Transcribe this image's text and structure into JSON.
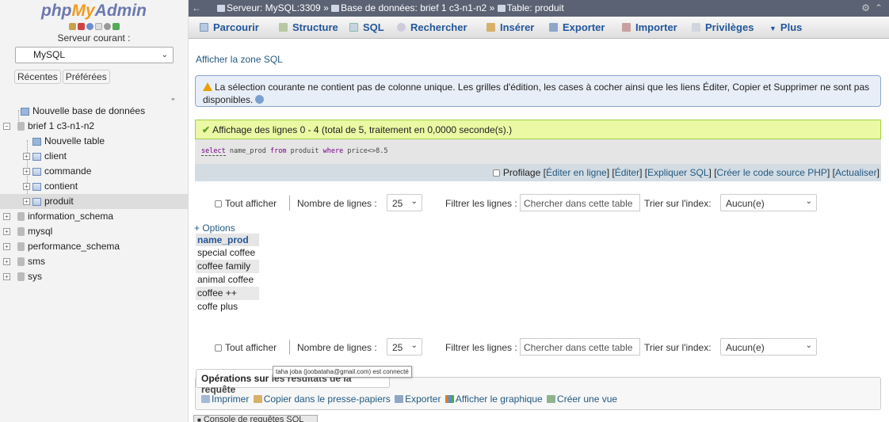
{
  "sidebar": {
    "logo_php": "php",
    "logo_my": "My",
    "logo_admin": "Admin",
    "server_label": "Serveur courant :",
    "server_select": "MySQL",
    "tab_recent": "Récentes",
    "tab_favorites": "Préférées",
    "tree": {
      "new_db": "Nouvelle base de données",
      "db_brief": "brief 1 c3-n1-n2",
      "new_table": "Nouvelle table",
      "tables": [
        "client",
        "commande",
        "contient",
        "produit"
      ],
      "other_dbs": [
        "information_schema",
        "mysql",
        "performance_schema",
        "sms",
        "sys"
      ]
    }
  },
  "topbar": {
    "back": "←",
    "server": "Serveur: MySQL:3309",
    "sep1": "»",
    "database": "Base de données: brief 1 c3-n1-n2",
    "sep2": "»",
    "table": "Table: produit",
    "gear": "⚙",
    "collapse": "⌃"
  },
  "menu": {
    "browse": "Parcourir",
    "structure": "Structure",
    "sql": "SQL",
    "search": "Rechercher",
    "insert": "Insérer",
    "export": "Exporter",
    "import": "Importer",
    "privileges": "Privilèges",
    "more": "Plus"
  },
  "show_sql_link": "Afficher la zone SQL",
  "notice": {
    "text": "La sélection courante ne contient pas de colonne unique. Les grilles d'édition, les cases à cocher ainsi que les liens Éditer, Copier et Supprimer ne sont pas disponibles."
  },
  "success": {
    "text": "Affichage des lignes 0 - 4 (total de 5, traitement en 0,0000 seconde(s).)"
  },
  "query": {
    "kw_select": "select",
    "field": "name_prod",
    "kw_from": "from",
    "table": "produit",
    "kw_where": "where",
    "cond": "price<>8.5"
  },
  "profbar": {
    "profiling": "Profilage",
    "edit_inline": "Éditer en ligne",
    "edit": "Éditer",
    "explain": "Expliquer SQL",
    "php_code": "Créer le code source PHP",
    "refresh": "Actualiser",
    "lb": "[",
    "rb": "]"
  },
  "nav": {
    "show_all": "Tout afficher",
    "rows_label": "Nombre de lignes :",
    "rows_value": "25",
    "filter_label": "Filtrer les lignes :",
    "filter_placeholder": "Chercher dans cette table",
    "sort_label": "Trier sur l'index:",
    "sort_value": "Aucun(e)"
  },
  "options_link": "+ Options",
  "results": {
    "column": "name_prod",
    "rows": [
      "special coffee",
      "coffee family",
      "animal coffee",
      "coffee ++",
      "coffe plus"
    ]
  },
  "ops": {
    "legend_a": "Opérations sur",
    "legend_b": "les résultats de la requête",
    "tooltip": "taha joba (joobataha@gmail.com) est connecté",
    "print": "Imprimer",
    "copy": "Copier dans le presse-papiers",
    "export": "Exporter",
    "chart": "Afficher le graphique",
    "view": "Créer une vue"
  },
  "console": "Console de requêtes SQL"
}
